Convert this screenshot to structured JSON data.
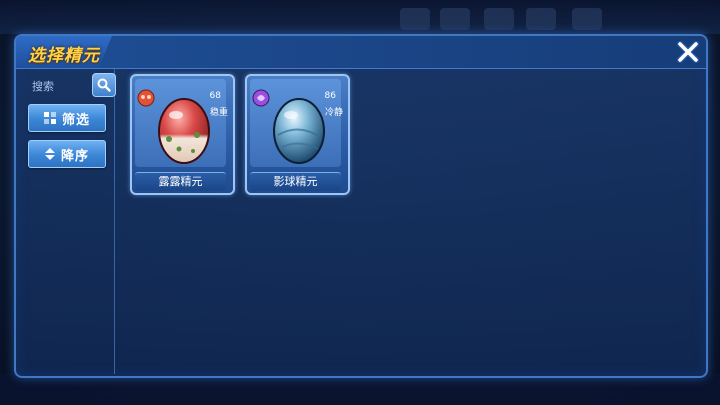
{
  "dialog": {
    "title": "选择精元",
    "close_icon": "close-x-icon"
  },
  "sidebar": {
    "search_label": "搜索",
    "search_icon": "search-icon",
    "filter_label": "筛选",
    "filter_icon": "grid-filter-icon",
    "sort_label": "降序",
    "sort_icon": "sort-updown-icon"
  },
  "cards": [
    {
      "name": "露露精元",
      "level": "68",
      "nature": "稳重",
      "egg_color": "#d84a48",
      "badge_color": "#e0533a",
      "badge_icon": "fire-element-icon"
    },
    {
      "name": "影球精元",
      "level": "86",
      "nature": "冷静",
      "egg_color": "#4d8fb5",
      "badge_color": "#9a4fe0",
      "badge_icon": "dark-element-icon"
    }
  ],
  "colors": {
    "title": "#ffd24a",
    "panel_border": "#3f78c4",
    "button": "#3b86d6"
  }
}
